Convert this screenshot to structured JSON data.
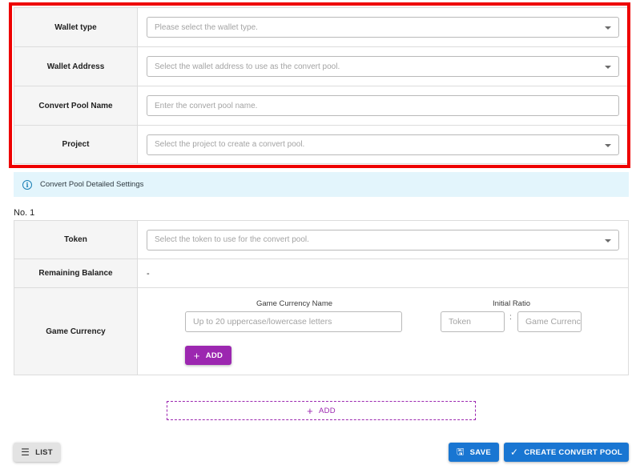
{
  "basic_settings": {
    "wallet_type": {
      "label": "Wallet type",
      "placeholder": "Please select the wallet type."
    },
    "wallet_address": {
      "label": "Wallet Address",
      "placeholder": "Select the wallet address to use as the convert pool."
    },
    "pool_name": {
      "label": "Convert Pool Name",
      "placeholder": "Enter the convert pool name."
    },
    "project": {
      "label": "Project",
      "placeholder": "Select the project to create a convert pool."
    }
  },
  "info_bar": {
    "icon": "info-icon",
    "text": "Convert Pool Detailed Settings"
  },
  "pool_item": {
    "title": "No. 1",
    "token": {
      "label": "Token",
      "placeholder": "Select the token to use for the convert pool."
    },
    "remaining_balance": {
      "label": "Remaining Balance",
      "value": "-"
    },
    "game_currency": {
      "label": "Game Currency",
      "name_header": "Game Currency Name",
      "name_placeholder": "Up to 20 uppercase/lowercase letters",
      "ratio_header": "Initial Ratio",
      "ratio_token_placeholder": "Token",
      "ratio_separator": ":",
      "ratio_currency_placeholder": "Game Currency",
      "add_label": "ADD"
    }
  },
  "add_pool_label": "ADD",
  "footer": {
    "list_label": "LIST",
    "save_label": "SAVE",
    "create_label": "CREATE CONVERT POOL"
  },
  "colors": {
    "highlight": "#ee0000",
    "purple": "#9c27b0",
    "blue": "#1976d2",
    "info_bg": "#e3f5fc"
  }
}
